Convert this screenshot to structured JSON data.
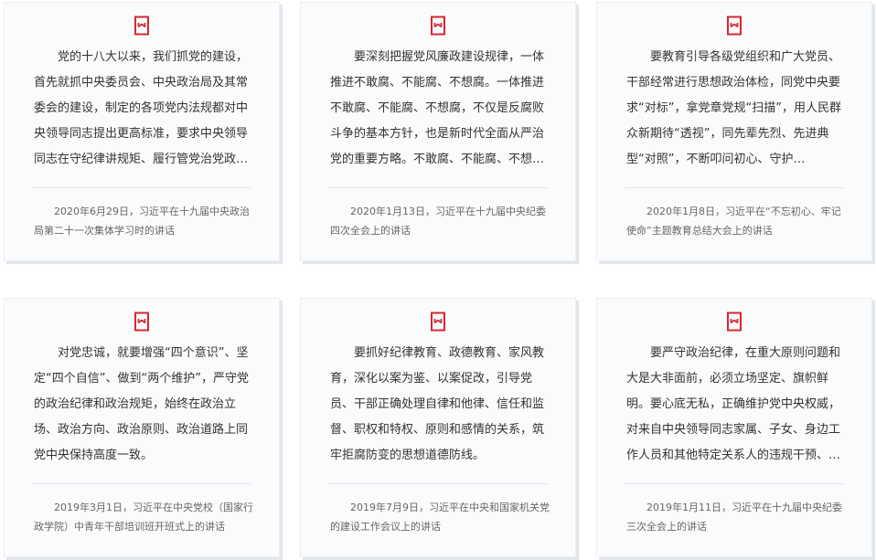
{
  "accent_color": "#d7282f",
  "cards": [
    {
      "icon": "bookmark-icon",
      "text": "党的十八大以来，我们抓党的建设，首先就抓中央委员会、中央政治局及其常委会的建设，制定的各项党内法规都对中央领导同志提出更高标准，要求中央领导同志在守纪律讲规矩、履行管党治党政…",
      "source": "2020年6月29日，习近平在十九届中央政治局第二十一次集体学习时的讲话"
    },
    {
      "icon": "bookmark-icon",
      "text": "要深刻把握党风廉政建设规律，一体推进不敢腐、不能腐、不想腐。一体推进不敢腐、不能腐、不想腐，不仅是反腐败斗争的基本方针，也是新时代全面从严治党的重要方略。不敢腐、不能腐、不想…",
      "source": "2020年1月13日，习近平在十九届中央纪委四次全会上的讲话"
    },
    {
      "icon": "bookmark-icon",
      "text": "要教育引导各级党组织和广大党员、干部经常进行思想政治体检，同党中央要求“对标”，拿党章党规“扫描”，用人民群众新期待“透视”，同先辈先烈、先进典型“对照”，不断叩问初心、守护…",
      "source": "2020年1月8日，习近平在“不忘初心、牢记使命”主题教育总结大会上的讲话"
    },
    {
      "icon": "bookmark-icon",
      "text": "对党忠诚，就要增强“四个意识”、坚定“四个自信”、做到“两个维护”，严守党的政治纪律和政治规矩，始终在政治立场、政治方向、政治原则、政治道路上同党中央保持高度一致。",
      "source": "2019年3月1日，习近平在中央党校（国家行政学院）中青年干部培训班开班式上的讲话"
    },
    {
      "icon": "bookmark-icon",
      "text": "要抓好纪律教育、政德教育、家风教育，深化以案为鉴、以案促改，引导党员、干部正确处理自律和他律、信任和监督、职权和特权、原则和感情的关系，筑牢拒腐防变的思想道德防线。",
      "source": "2019年7月9日，习近平在中央和国家机关党的建设工作会议上的讲话"
    },
    {
      "icon": "bookmark-icon",
      "text": "要严守政治纪律，在重大原则问题和大是大非面前，必须立场坚定、旗帜鲜明。要心底无私，正确维护党中央权威，对来自中央领导同志家属、子女、身边工作人员和其他特定关系人的违规干预、…",
      "source": "2019年1月11日，习近平在十九届中央纪委三次全会上的讲话"
    }
  ]
}
